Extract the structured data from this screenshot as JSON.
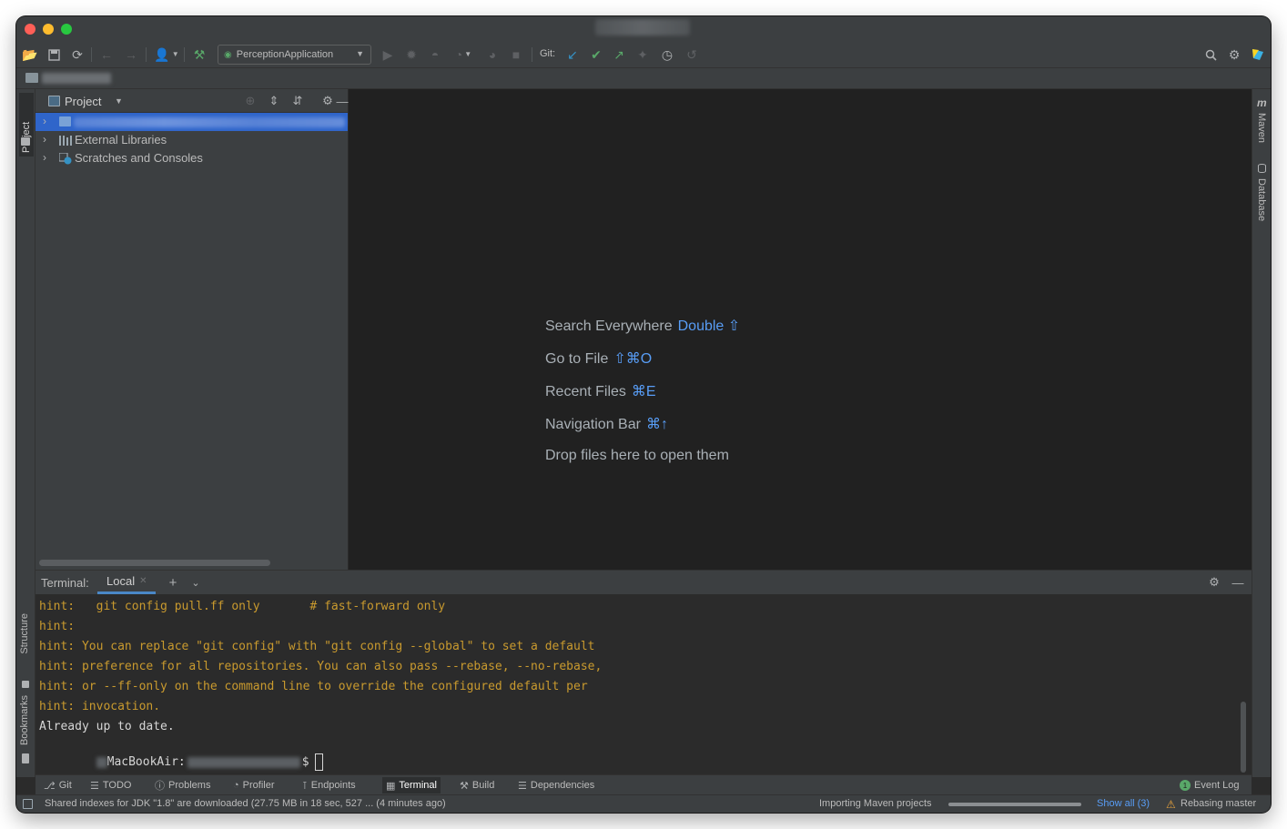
{
  "toolbar": {
    "run_config": "PerceptionApplication",
    "git_label": "Git:"
  },
  "project_panel": {
    "title": "Project",
    "tree": [
      {
        "label": "External Libraries"
      },
      {
        "label": "Scratches and Consoles"
      }
    ]
  },
  "side_tabs": {
    "left_top": "Project",
    "left_structure": "Structure",
    "left_bookmarks": "Bookmarks",
    "right_maven": "Maven",
    "right_database": "Database"
  },
  "editor_hints": [
    {
      "text": "Search Everywhere",
      "key": "Double ⇧"
    },
    {
      "text": "Go to File",
      "key": "⇧⌘O"
    },
    {
      "text": "Recent Files",
      "key": "⌘E"
    },
    {
      "text": "Navigation Bar",
      "key": "⌘↑"
    },
    {
      "text": "Drop files here to open them",
      "key": ""
    }
  ],
  "terminal": {
    "title": "Terminal:",
    "tab": "Local",
    "lines": [
      "hint:   git config pull.ff only       # fast-forward only",
      "hint:",
      "hint: You can replace \"git config\" with \"git config --global\" to set a default",
      "hint: preference for all repositories. You can also pass --rebase, --no-rebase,",
      "hint: or --ff-only on the command line to override the configured default per",
      "hint: invocation.",
      "Already up to date."
    ],
    "prompt_host": "MacBookAir:",
    "prompt_suffix": "$"
  },
  "tool_tabs": [
    {
      "label": "Git",
      "icon": "branch-icon"
    },
    {
      "label": "TODO",
      "icon": "list-icon"
    },
    {
      "label": "Problems",
      "icon": "problems-icon"
    },
    {
      "label": "Profiler",
      "icon": "profiler-icon"
    },
    {
      "label": "Endpoints",
      "icon": "endpoints-icon"
    },
    {
      "label": "Terminal",
      "icon": "terminal-icon"
    },
    {
      "label": "Build",
      "icon": "hammer-icon"
    },
    {
      "label": "Dependencies",
      "icon": "layers-icon"
    }
  ],
  "event_log": {
    "label": "Event Log",
    "count": "1"
  },
  "status": {
    "message": "Shared indexes for JDK \"1.8\" are downloaded (27.75 MB in 18 sec, 527 ... (4 minutes ago)",
    "task": "Importing Maven projects",
    "show_all": "Show all (3)",
    "rebasing": "Rebasing master",
    "progress": 1.0
  }
}
